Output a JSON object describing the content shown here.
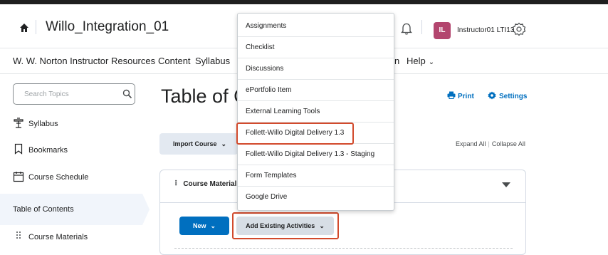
{
  "header": {
    "course_title": "Willo_Integration_01",
    "avatar_initials": "IL",
    "avatar_color": "#b3456e",
    "username": "Instructor01 LTI13"
  },
  "navbar": {
    "items": [
      {
        "label": "W. W. Norton Instructor Resources"
      },
      {
        "label": "Content"
      },
      {
        "label": "Syllabus"
      }
    ],
    "partial_label": "n",
    "help_label": "Help"
  },
  "sidebar": {
    "search_placeholder": "Search Topics",
    "items": [
      {
        "label": "Syllabus",
        "icon": "lectern-icon"
      },
      {
        "label": "Bookmarks",
        "icon": "bookmark-icon"
      },
      {
        "label": "Course Schedule",
        "icon": "calendar-icon"
      }
    ],
    "toc_label": "Table of Contents",
    "module_label": "Course Materials"
  },
  "main": {
    "page_title": "Table of C",
    "print_label": "Print",
    "settings_label": "Settings",
    "import_label": "Import Course",
    "expand_all": "Expand All",
    "collapse_all": "Collapse All",
    "module_title": "Course Material",
    "new_label": "New",
    "add_existing_label": "Add Existing Activities"
  },
  "dropdown": {
    "items": [
      {
        "label": "Assignments"
      },
      {
        "label": "Checklist"
      },
      {
        "label": "Discussions"
      },
      {
        "label": "ePortfolio Item"
      },
      {
        "label": "External Learning Tools"
      },
      {
        "label": "Follett-Willo Digital Delivery 1.3"
      },
      {
        "label": "Follett-Willo Digital Delivery 1.3 - Staging"
      },
      {
        "label": "Form Templates"
      },
      {
        "label": "Google Drive"
      }
    ]
  },
  "colors": {
    "primary_blue": "#006fbf",
    "highlight_red": "#d24a2c"
  }
}
